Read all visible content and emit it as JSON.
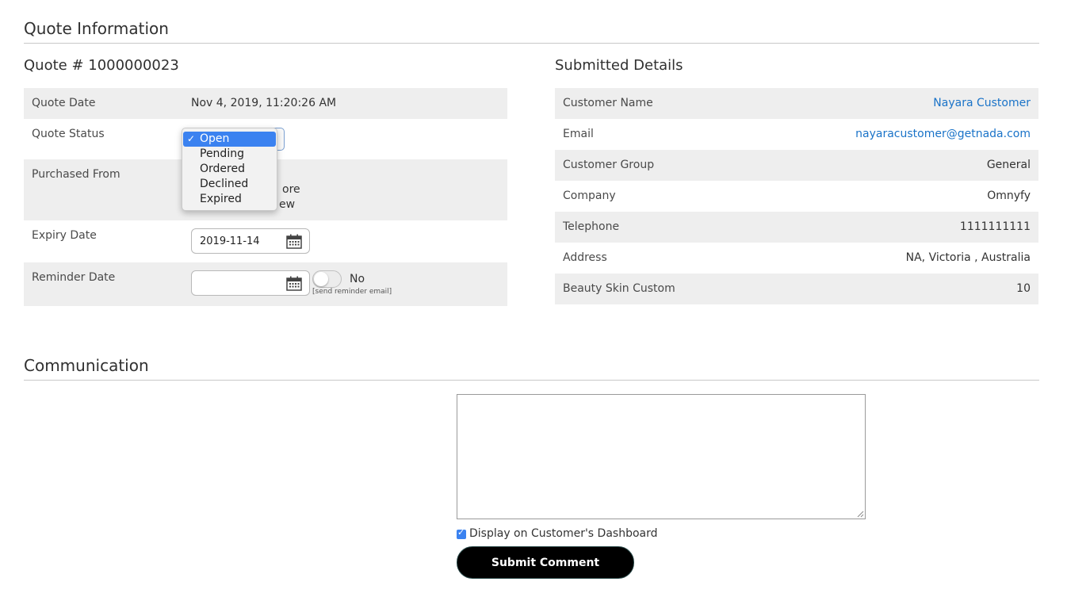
{
  "quote_info": {
    "section_title": "Quote Information",
    "quote_number_title": "Quote # 1000000023",
    "rows": {
      "quote_date": {
        "label": "Quote Date",
        "value": "Nov 4, 2019, 11:20:26 AM"
      },
      "quote_status": {
        "label": "Quote Status"
      },
      "purchased_from": {
        "label": "Purchased From",
        "line1_partial": "ore",
        "line2_partial": "ew"
      },
      "expiry_date": {
        "label": "Expiry Date",
        "value": "2019-11-14"
      },
      "reminder_date": {
        "label": "Reminder Date",
        "value": "",
        "toggle_label": "No",
        "toggle_hint": "[send reminder email]"
      }
    },
    "status_dropdown": {
      "selected": "Open",
      "options": [
        "Open",
        "Pending",
        "Ordered",
        "Declined",
        "Expired"
      ]
    }
  },
  "submitted_details": {
    "title": "Submitted Details",
    "rows": [
      {
        "label": "Customer Name",
        "value": "Nayara Customer"
      },
      {
        "label": "Email",
        "value": "nayaracustomer@getnada.com"
      },
      {
        "label": "Customer Group",
        "value": "General"
      },
      {
        "label": "Company",
        "value": "Omnyfy"
      },
      {
        "label": "Telephone",
        "value": "1111111111"
      },
      {
        "label": "Address",
        "value": "NA, Victoria , Australia"
      },
      {
        "label": "Beauty Skin Custom",
        "value": "10"
      }
    ]
  },
  "communication": {
    "section_title": "Communication",
    "comment_placeholder": "",
    "display_on_dashboard_label": "Display on Customer's Dashboard",
    "display_on_dashboard_checked": true,
    "submit_label": "Submit Comment"
  },
  "colors": {
    "link": "#1a73c8",
    "row_shade": "#eeeeee",
    "selected_option": "#3b82f0",
    "button_bg": "#000000"
  }
}
